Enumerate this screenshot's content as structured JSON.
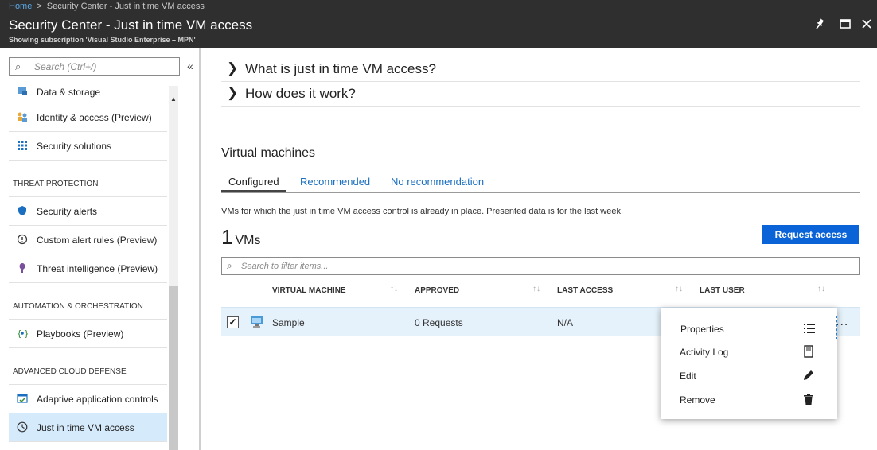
{
  "breadcrumb": {
    "home": "Home",
    "separator": ">",
    "current": "Security Center - Just in time VM access"
  },
  "header": {
    "title": "Security Center - Just in time VM access",
    "subtitle": "Showing subscription 'Visual Studio Enterprise – MPN'",
    "icons": [
      "pin-icon",
      "maximize-icon",
      "close-icon"
    ]
  },
  "sidebar": {
    "search_placeholder": "Search (Ctrl+/)",
    "collapse_glyph": "«",
    "items_top": [
      {
        "label": "Data & storage",
        "icon": "data-storage-icon"
      },
      {
        "label": "Identity & access (Preview)",
        "icon": "identity-icon"
      },
      {
        "label": "Security solutions",
        "icon": "grid-icon"
      }
    ],
    "threat_heading": "THREAT PROTECTION",
    "threat_items": [
      {
        "label": "Security alerts",
        "icon": "shield-icon"
      },
      {
        "label": "Custom alert rules (Preview)",
        "icon": "alert-rule-icon"
      },
      {
        "label": "Threat intelligence (Preview)",
        "icon": "threat-intel-icon"
      }
    ],
    "automation_heading": "AUTOMATION & ORCHESTRATION",
    "automation_items": [
      {
        "label": "Playbooks (Preview)",
        "icon": "playbook-icon"
      }
    ],
    "defense_heading": "ADVANCED CLOUD DEFENSE",
    "defense_items": [
      {
        "label": "Adaptive application controls",
        "icon": "app-controls-icon"
      },
      {
        "label": "Just in time VM access",
        "icon": "clock-icon",
        "active": true
      }
    ]
  },
  "main": {
    "accordion": [
      {
        "label": "What is just in time VM access?"
      },
      {
        "label": "How does it work?"
      }
    ],
    "section_title": "Virtual machines",
    "tabs": [
      {
        "label": "Configured",
        "active": true
      },
      {
        "label": "Recommended"
      },
      {
        "label": "No recommendation"
      }
    ],
    "description": "VMs for which the just in time VM access control is already in place. Presented data is for the last week.",
    "vm_count": "1",
    "vm_count_unit": "VMs",
    "request_button": "Request access",
    "filter_placeholder": "Search to filter items...",
    "columns": [
      "VIRTUAL MACHINE",
      "APPROVED",
      "LAST ACCESS",
      "LAST USER"
    ],
    "sort_glyph": "↑↓",
    "rows": [
      {
        "checked": true,
        "name": "Sample",
        "approved": "0 Requests",
        "last_access": "N/A",
        "last_user": ""
      }
    ],
    "more_glyph": "..."
  },
  "context_menu": {
    "items": [
      {
        "label": "Properties",
        "icon": "list-icon"
      },
      {
        "label": "Activity Log",
        "icon": "log-icon"
      },
      {
        "label": "Edit",
        "icon": "pencil-icon"
      },
      {
        "label": "Remove",
        "icon": "trash-icon"
      }
    ]
  },
  "colors": {
    "accent": "#0a64d8",
    "header_bg": "#2f2f2f",
    "selected_row": "#e6f2fb",
    "active_nav": "#d5eafb",
    "highlight": "#ffff3a"
  }
}
